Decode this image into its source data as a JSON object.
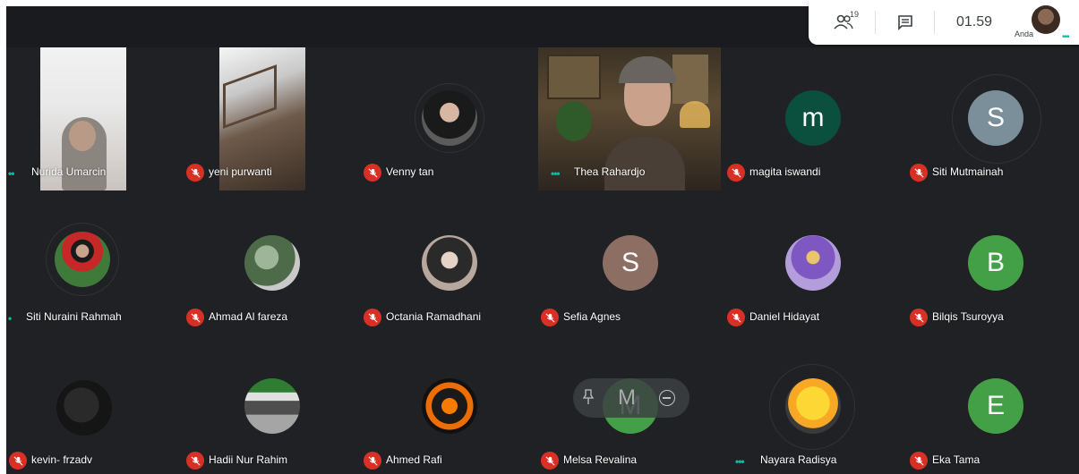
{
  "toolbar": {
    "people_count": "19",
    "clock": "01.59",
    "self_label": "Anda",
    "self_dots": "•••"
  },
  "row1": [
    {
      "name": "Nurida Umarcin",
      "status": "speaking",
      "dots": "••"
    },
    {
      "name": "yeni purwanti",
      "status": "muted"
    },
    {
      "name": "Venny tan",
      "status": "muted"
    },
    {
      "name": "Thea Rahardjo",
      "status": "speaking",
      "dots": "•••"
    },
    {
      "name": "magita iswandi",
      "status": "muted",
      "initial": "m",
      "color": "#0b4f3f"
    },
    {
      "name": "Siti Mutmainah",
      "status": "muted",
      "initial": "S",
      "color": "#7b8f9b"
    }
  ],
  "row2": [
    {
      "name": "Siti Nuraini Rahmah",
      "status": "speaking",
      "dots": "•"
    },
    {
      "name": "Ahmad Al fareza",
      "status": "muted"
    },
    {
      "name": "Octania Ramadhani",
      "status": "muted"
    },
    {
      "name": "Sefia Agnes",
      "status": "muted",
      "initial": "S",
      "color": "#8d6e63"
    },
    {
      "name": "Daniel Hidayat",
      "status": "muted"
    },
    {
      "name": "Bilqis Tsuroyya",
      "status": "muted",
      "initial": "B",
      "color": "#43a047"
    }
  ],
  "row3": [
    {
      "name": "kevin- frzadv",
      "status": "muted"
    },
    {
      "name": "Hadii Nur Rahim",
      "status": "muted"
    },
    {
      "name": "Ahmed Rafi",
      "status": "muted"
    },
    {
      "name": "Melsa Revalina",
      "status": "muted",
      "initial": "M",
      "color": "#43a047"
    },
    {
      "name": "Nayara Radisya",
      "status": "speaking",
      "dots": "•••"
    },
    {
      "name": "Eka Tama",
      "status": "muted",
      "initial": "E",
      "color": "#43a047"
    }
  ],
  "hover": {
    "initial": "M"
  },
  "colors": {
    "muted": "#d93025",
    "speaking": "#00bfa5",
    "background": "#202124"
  }
}
